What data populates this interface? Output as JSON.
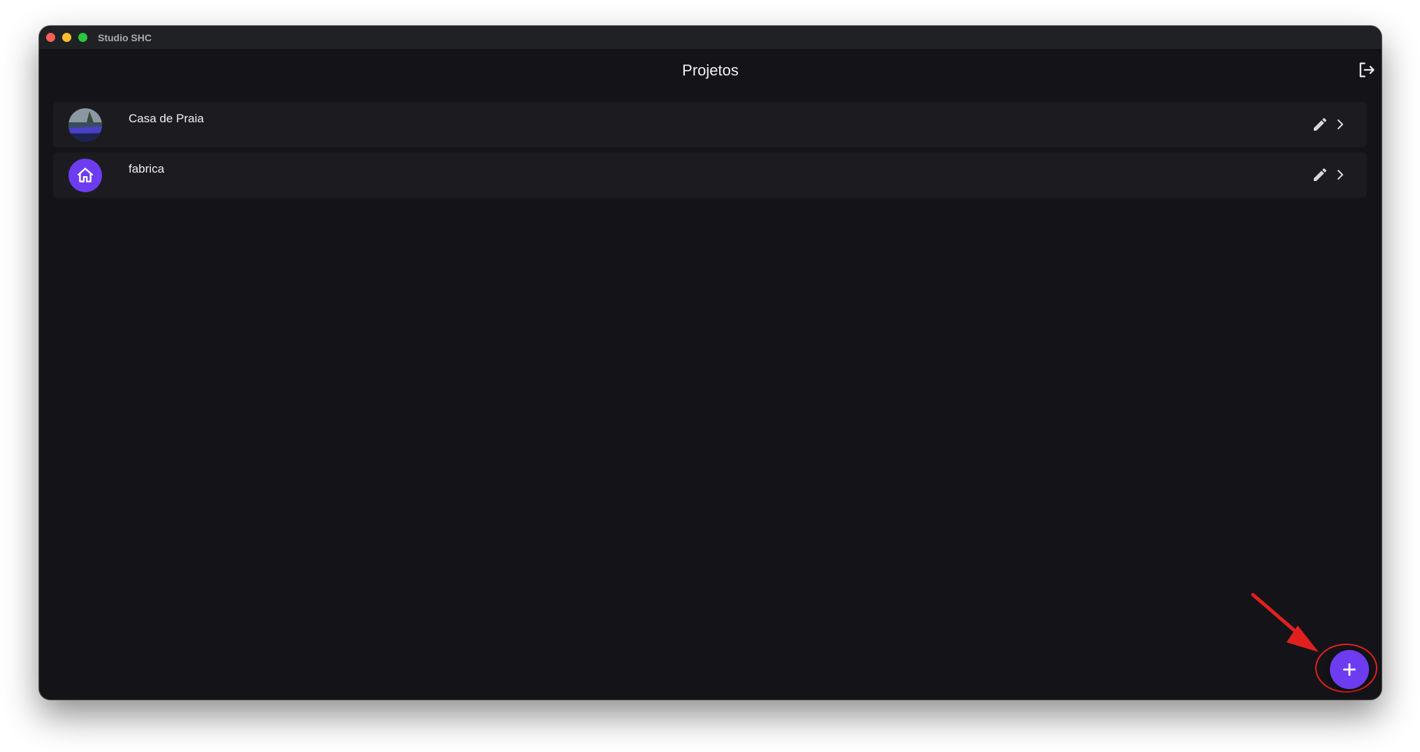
{
  "window": {
    "title": "Studio SHC"
  },
  "appbar": {
    "title": "Projetos",
    "logout_icon": "logout-icon"
  },
  "projects": [
    {
      "name": "Casa de Praia",
      "avatar": "photo",
      "edit_icon": "pencil-icon",
      "open_icon": "chevron-right-icon"
    },
    {
      "name": "fabrica",
      "avatar": "home-icon",
      "edit_icon": "pencil-icon",
      "open_icon": "chevron-right-icon"
    }
  ],
  "fab": {
    "icon": "plus-icon"
  },
  "colors": {
    "background": "#141418",
    "card": "#1c1c20",
    "accent": "#6d3cf0",
    "annotation": "#e21f1f"
  }
}
